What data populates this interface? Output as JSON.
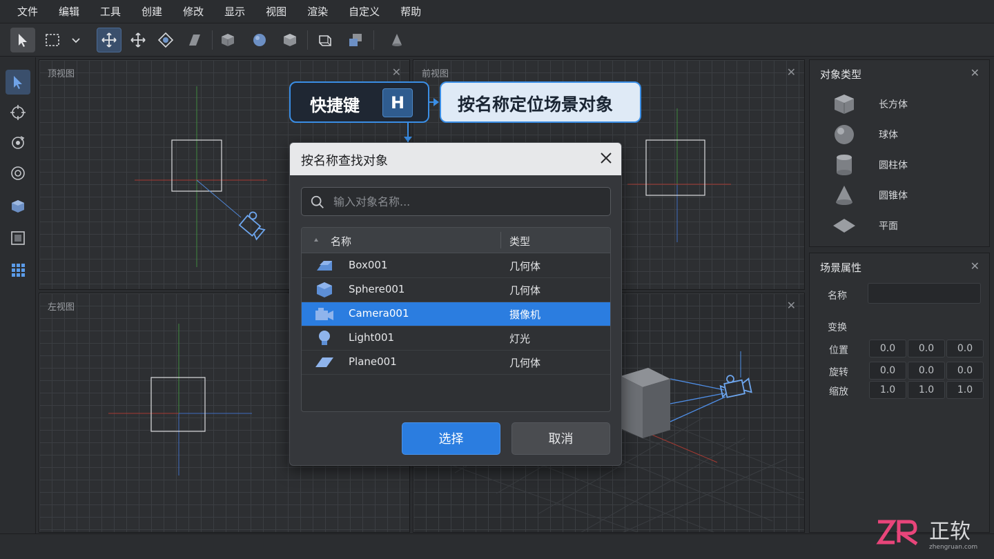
{
  "menu": [
    "文件",
    "编辑",
    "工具",
    "创建",
    "修改",
    "显示",
    "视图",
    "渲染",
    "自定义",
    "帮助"
  ],
  "viewports": {
    "top": "顶视图",
    "front": "前视图",
    "left": "左视图",
    "close": "✕"
  },
  "callout": {
    "key_label": "快捷键",
    "key": "H",
    "description": "按名称定位场景对象"
  },
  "dialog": {
    "title": "按名称查找对象",
    "search_placeholder": "输入对象名称...",
    "columns": {
      "name": "名称",
      "type": "类型"
    },
    "rows": [
      {
        "name": "Box001",
        "type": "几何体",
        "icon": "box-icon"
      },
      {
        "name": "Sphere001",
        "type": "几何体",
        "icon": "sphere-icon"
      },
      {
        "name": "Camera001",
        "type": "摄像机",
        "icon": "camera-icon",
        "selected": true
      },
      {
        "name": "Light001",
        "type": "灯光",
        "icon": "light-icon"
      },
      {
        "name": "Plane001",
        "type": "几何体",
        "icon": "plane-icon"
      }
    ],
    "select_button": "选择",
    "cancel_button": "取消"
  },
  "object_types": {
    "title": "对象类型",
    "items": [
      {
        "label": "长方体",
        "icon": "box-icon"
      },
      {
        "label": "球体",
        "icon": "sphere-icon"
      },
      {
        "label": "圆柱体",
        "icon": "cylinder-icon"
      },
      {
        "label": "圆锥体",
        "icon": "cone-icon"
      },
      {
        "label": "平面",
        "icon": "plane-icon"
      }
    ]
  },
  "scene_props": {
    "title": "场景属性",
    "name_label": "名称",
    "name_value": "",
    "transform_label": "变换",
    "position_label": "位置",
    "rotation_label": "旋转",
    "scale_label": "缩放",
    "position": [
      "0.0",
      "0.0",
      "0.0"
    ],
    "rotation": [
      "0.0",
      "0.0",
      "0.0"
    ],
    "scale": [
      "1.0",
      "1.0",
      "1.0"
    ]
  },
  "watermark": {
    "brand": "正软",
    "url": "zhengruan.com"
  },
  "colors": {
    "accent": "#2b7de0",
    "callout_border": "#3a8ee6"
  }
}
